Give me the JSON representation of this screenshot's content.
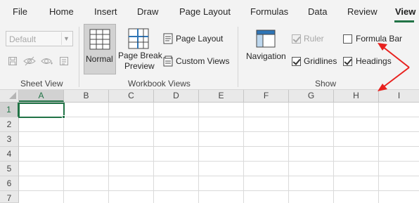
{
  "tabs": [
    "File",
    "Home",
    "Insert",
    "Draw",
    "Page Layout",
    "Formulas",
    "Data",
    "Review",
    "View"
  ],
  "active_tab": "View",
  "sheet_view": {
    "dropdown_value": "Default",
    "group_label": "Sheet View",
    "icons": [
      "save-view-icon",
      "eye-icon",
      "eye-plus-icon",
      "options-icon"
    ]
  },
  "workbook_views": {
    "normal_label": "Normal",
    "page_break_line1": "Page Break",
    "page_break_line2": "Preview",
    "page_layout_label": "Page Layout",
    "custom_views_label": "Custom Views",
    "group_label": "Workbook Views"
  },
  "show": {
    "navigation_label": "Navigation",
    "ruler": {
      "label": "Ruler",
      "checked": true,
      "disabled": true
    },
    "gridlines": {
      "label": "Gridlines",
      "checked": true
    },
    "formula_bar": {
      "label": "Formula Bar",
      "checked": false
    },
    "headings": {
      "label": "Headings",
      "checked": true
    },
    "group_label": "Show"
  },
  "columns": [
    "A",
    "B",
    "C",
    "D",
    "E",
    "F",
    "G",
    "H",
    "I"
  ],
  "rows": [
    "1",
    "2",
    "3",
    "4",
    "5",
    "6",
    "7"
  ],
  "selected_cell": "A1",
  "colors": {
    "accent": "#217346",
    "annotation_arrow": "#e8211e",
    "ribbon_bg": "#f3f3f3"
  }
}
